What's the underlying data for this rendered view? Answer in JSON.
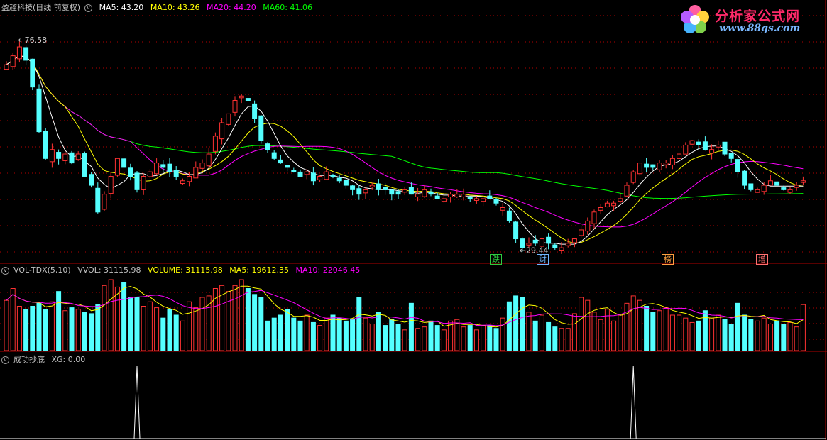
{
  "stock_header": {
    "name": "盈趣科技(日线 前复权)",
    "ma5": "MA5: 43.20",
    "ma10": "MA10: 43.26",
    "ma20": "MA20: 44.20",
    "ma60": "MA60: 41.06"
  },
  "volume_header": {
    "name": "VOL-TDX(5,10)",
    "vvol": "VVOL: 31115.98",
    "volume": "VOLUME: 31115.98",
    "ma5": "MA5: 19612.35",
    "ma10": "MA10: 22046.45"
  },
  "indicator_header": {
    "name": "成功抄底",
    "xg": "XG: 0.00"
  },
  "logo": {
    "title": "分析家公式网",
    "url": "www.88gs.com"
  },
  "news_tags": [
    {
      "text": "跌",
      "color": "#2ecc40"
    },
    {
      "text": "财",
      "color": "#6fb6ff"
    },
    {
      "text": "榜",
      "color": "#ffa040"
    },
    {
      "text": "增",
      "color": "#ff7070"
    }
  ],
  "colors": {
    "up": "#ff3232",
    "down": "#54ffff",
    "ma5": "#ffffff",
    "ma10": "#ffff00",
    "ma20": "#ff00ff",
    "ma60": "#00ff00",
    "grid": "#b00000",
    "text": "#c0c0c0"
  },
  "chart_data": [
    {
      "type": "candlestick",
      "title": "盈趣科技(日线 前复权)",
      "series": [
        {
          "name": "MA5",
          "last": 43.2
        },
        {
          "name": "MA10",
          "last": 43.26
        },
        {
          "name": "MA20",
          "last": 44.2
        },
        {
          "name": "MA60",
          "last": 41.06
        }
      ],
      "annotations": [
        {
          "label": "76.58",
          "value": 76.58
        },
        {
          "label": "29.44",
          "value": 29.44
        }
      ],
      "ylim": [
        27,
        82
      ],
      "close": [
        71,
        73,
        75,
        72,
        66,
        56,
        50,
        52,
        50,
        51,
        49,
        51,
        46,
        44,
        38,
        42,
        46,
        50,
        48,
        46,
        43,
        46,
        47,
        49,
        48,
        47,
        46,
        45,
        46,
        48,
        49,
        51,
        55,
        58,
        60,
        63,
        64,
        63,
        59,
        54,
        52,
        50,
        49,
        48,
        47,
        46,
        47,
        45,
        46,
        47,
        46,
        45,
        44,
        43,
        42,
        43,
        44,
        43,
        43,
        42,
        42,
        43,
        42,
        42,
        43,
        42,
        41,
        41,
        42,
        42,
        42,
        41,
        41,
        41,
        41,
        40,
        39,
        36,
        32,
        30,
        31,
        31,
        32,
        31,
        30,
        30,
        31,
        32,
        34,
        36,
        38,
        39,
        40,
        40,
        41,
        44,
        47,
        49,
        48,
        48,
        49,
        49,
        50,
        51,
        53,
        54,
        53,
        52,
        52,
        53,
        51,
        50,
        47,
        44,
        43,
        43,
        44,
        45,
        44,
        43,
        43,
        44,
        45
      ],
      "volume": [
        34000,
        42000,
        30000,
        28000,
        30000,
        32000,
        28000,
        33000,
        40000,
        27000,
        29000,
        28000,
        26000,
        25000,
        31000,
        44000,
        48000,
        43000,
        46000,
        36000,
        36000,
        30000,
        33000,
        29000,
        22000,
        28000,
        24000,
        20000,
        33000,
        29000,
        36000,
        37000,
        42000,
        44000,
        40000,
        44000,
        48000,
        42000,
        38000,
        36000,
        20000,
        22000,
        24000,
        28000,
        22000,
        20000,
        24000,
        19000,
        17000,
        22000,
        24000,
        22000,
        20000,
        21000,
        36000,
        22000,
        18000,
        26000,
        17000,
        21000,
        18000,
        14000,
        32000,
        15000,
        16000,
        20000,
        17000,
        14000,
        20000,
        21000,
        16000,
        17000,
        14000,
        17000,
        17000,
        15000,
        22000,
        33000,
        37000,
        36000,
        26000,
        20000,
        24000,
        19000,
        16000,
        15000,
        15000,
        25000,
        36000,
        34000,
        26000,
        21000,
        28000,
        20000,
        24000,
        32000,
        37000,
        34000,
        30000,
        26000,
        27000,
        29000,
        24000,
        24000,
        22000,
        19000,
        20000,
        27000,
        22000,
        24000,
        21000,
        18000,
        32000,
        24000,
        21000,
        20000,
        22000,
        18000,
        20000,
        18000,
        19000,
        16000,
        31116
      ],
      "ylabel": ""
    },
    {
      "type": "line",
      "title": "成功抄底",
      "series": [
        {
          "name": "XG",
          "x": [
            20,
            96
          ],
          "values": [
            1,
            1
          ],
          "last": 0.0
        }
      ],
      "ylim": [
        0,
        1
      ]
    }
  ]
}
